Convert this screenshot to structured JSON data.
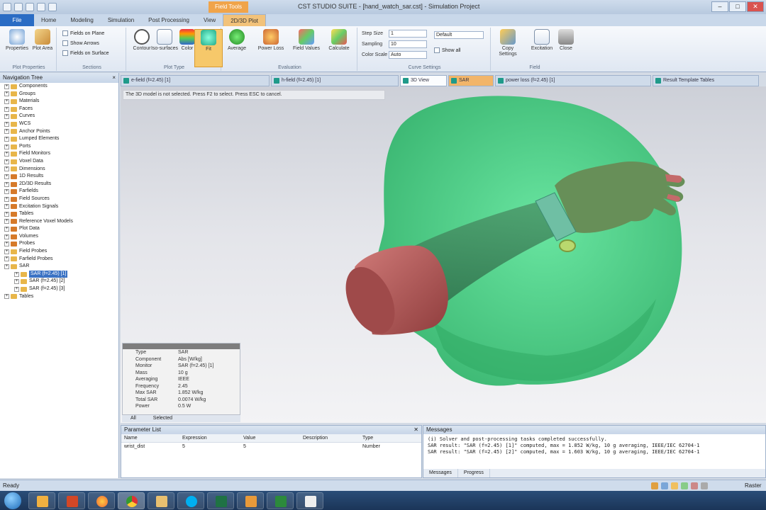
{
  "window": {
    "title": "CST STUDIO SUITE - [hand_watch_sar.cst] - Simulation Project",
    "controls": [
      "–",
      "□",
      "✕"
    ]
  },
  "ribbon_tabs": {
    "file": "File",
    "tabs": [
      "Home",
      "Modeling",
      "Simulation",
      "Post Processing",
      "View",
      "2D/3D Plot"
    ],
    "context_group": "Field Tools"
  },
  "ribbon": {
    "groups": [
      {
        "label": "Plot Properties",
        "buttons": [
          "Properties",
          "Plot Area"
        ]
      },
      {
        "label": "Sections",
        "checks": [
          "Fields on Plane",
          "Show Arrows",
          "Fields on Surface"
        ]
      },
      {
        "label": "Plot Type",
        "buttons": [
          "Contour",
          "Iso-surfaces",
          "Color",
          "Fit"
        ]
      },
      {
        "label": "Evaluation",
        "buttons": [
          "Average",
          "Power Loss",
          "Field Values",
          "Calculate"
        ]
      },
      {
        "label": "Curve Settings",
        "fields": [
          {
            "label": "Step Size",
            "value": "1"
          },
          {
            "label": "Sampling",
            "value": "10"
          },
          {
            "label": "Color Scale",
            "value": "Auto"
          }
        ],
        "dropdown": "Default",
        "check": "Show all"
      },
      {
        "label": "Field",
        "buttons": [
          "Copy Settings",
          "Excitation",
          "Close"
        ]
      }
    ]
  },
  "navigation_tree": {
    "title": "Navigation Tree",
    "items": [
      {
        "label": "Components",
        "level": 0
      },
      {
        "label": "Groups",
        "level": 0
      },
      {
        "label": "Materials",
        "level": 0
      },
      {
        "label": "Faces",
        "level": 0
      },
      {
        "label": "Curves",
        "level": 0
      },
      {
        "label": "WCS",
        "level": 0
      },
      {
        "label": "Anchor Points",
        "level": 0
      },
      {
        "label": "Lumped Elements",
        "level": 0
      },
      {
        "label": "Ports",
        "level": 0
      },
      {
        "label": "Field Monitors",
        "level": 0
      },
      {
        "label": "Voxel Data",
        "level": 0
      },
      {
        "label": "Dimensions",
        "level": 0
      },
      {
        "label": "1D Results",
        "level": 0,
        "orange": true
      },
      {
        "label": "2D/3D Results",
        "level": 0,
        "orange": true
      },
      {
        "label": "Farfields",
        "level": 0,
        "orange": true
      },
      {
        "label": "Field Sources",
        "level": 0,
        "orange": true
      },
      {
        "label": "Excitation Signals",
        "level": 0,
        "orange": true
      },
      {
        "label": "Tables",
        "level": 0,
        "orange": true
      },
      {
        "label": "Reference Voxel Models",
        "level": 0,
        "orange": true
      },
      {
        "label": "Plot Data",
        "level": 0,
        "orange": true
      },
      {
        "label": "Volumes",
        "level": 0,
        "orange": true
      },
      {
        "label": "Probes",
        "level": 0,
        "orange": true
      },
      {
        "label": "Field Probes",
        "level": 0
      },
      {
        "label": "Farfield Probes",
        "level": 0
      },
      {
        "label": "SAR",
        "level": 0
      },
      {
        "label": "SAR (f=2.45) [1]",
        "level": 1,
        "selected": true
      },
      {
        "label": "SAR (f=2.45) [2]",
        "level": 1
      },
      {
        "label": "SAR (f=2.45) [3]",
        "level": 1
      },
      {
        "label": "Tables",
        "level": 0
      }
    ]
  },
  "doc_tabs": [
    {
      "label": "e-field (f=2.45) [1]",
      "state": ""
    },
    {
      "label": "h-field (f=2.45) [1]",
      "state": ""
    },
    {
      "label": "3D View",
      "state": "active"
    },
    {
      "label": "SAR",
      "state": "orange"
    },
    {
      "label": "power loss (f=2.45) [1]",
      "state": ""
    },
    {
      "label": "Result Template Tables",
      "state": ""
    }
  ],
  "viewport": {
    "hint": "The 3D model is not selected. Press F2 to select. Press ESC to cancel."
  },
  "properties": {
    "rows": [
      {
        "k": "Type",
        "v": "SAR"
      },
      {
        "k": "Component",
        "v": "Abs [W/kg]"
      },
      {
        "k": "Monitor",
        "v": "SAR (f=2.45) [1]"
      },
      {
        "k": "Mass",
        "v": "10 g"
      },
      {
        "k": "Averaging",
        "v": "IEEE"
      },
      {
        "k": "Frequency",
        "v": "2.45"
      },
      {
        "k": "Max SAR",
        "v": "1.852 W/kg"
      },
      {
        "k": "Total SAR",
        "v": "0.0074 W/kg"
      },
      {
        "k": "Power",
        "v": "0.5 W"
      }
    ],
    "tabs": [
      "All",
      "Selected"
    ]
  },
  "parameter_list": {
    "title": "Parameter List",
    "columns": [
      "Name",
      "Expression",
      "Value",
      "Description",
      "Type"
    ],
    "rows": [
      [
        "wrist_dist",
        "5",
        "5",
        "",
        "Number"
      ]
    ]
  },
  "messages": {
    "title": "Messages",
    "lines": [
      "(i) Solver and post-processing tasks completed successfully.",
      "    SAR result: \"SAR (f=2.45) [1]\" computed, max = 1.852 W/kg, 10 g averaging, IEEE/IEC 62704-1",
      "    SAR result: \"SAR (f=2.45) [2]\" computed, max = 1.603 W/kg, 10 g averaging, IEEE/IEC 62704-1"
    ],
    "tabs": [
      "Messages",
      "Progress"
    ]
  },
  "status": {
    "text": "Ready",
    "zoom": "Raster"
  },
  "colors": {
    "body_green": "#3ecf7e",
    "arm_green": "#3a7f5a",
    "hand": "#5f8e55",
    "cuff": "#b55a5a",
    "watch": "#b5d36a"
  }
}
